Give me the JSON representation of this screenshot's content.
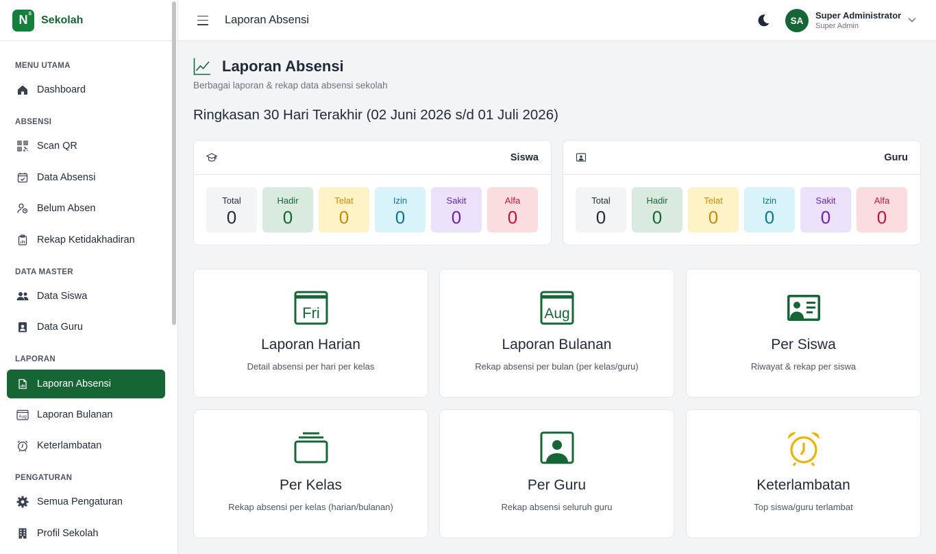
{
  "brand": {
    "name": "Sekolah",
    "logo_letter": "N",
    "logo_mark": "S"
  },
  "sidebar": {
    "sections": [
      {
        "label": "MENU UTAMA"
      },
      {
        "label": "ABSENSI"
      },
      {
        "label": "DATA MASTER"
      },
      {
        "label": "LAPORAN"
      },
      {
        "label": "PENGATURAN"
      }
    ],
    "items": [
      {
        "label": "Dashboard",
        "icon": "home-icon"
      },
      {
        "label": "Scan QR",
        "icon": "qr-code-icon"
      },
      {
        "label": "Data Absensi",
        "icon": "calendar-check-icon"
      },
      {
        "label": "Belum Absen",
        "icon": "user-clock-icon"
      },
      {
        "label": "Rekap Ketidakhadiran",
        "icon": "clipboard-chart-icon"
      },
      {
        "label": "Data Siswa",
        "icon": "users-icon"
      },
      {
        "label": "Data Guru",
        "icon": "teacher-badge-icon"
      },
      {
        "label": "Laporan Absensi",
        "icon": "report-icon",
        "active": true
      },
      {
        "label": "Laporan Bulanan",
        "icon": "calendar-month-icon"
      },
      {
        "label": "Keterlambatan",
        "icon": "alarm-icon"
      },
      {
        "label": "Semua Pengaturan",
        "icon": "gear-icon"
      },
      {
        "label": "Profil Sekolah",
        "icon": "building-icon"
      }
    ]
  },
  "header": {
    "title": "Laporan Absensi",
    "user": {
      "initials": "SA",
      "name": "Super Administrator",
      "role": "Super Admin"
    }
  },
  "page": {
    "title": "Laporan Absensi",
    "subtitle": "Berbagai laporan & rekap data absensi sekolah",
    "summary_title": "Ringkasan 30 Hari Terakhir (02 Juni 2026 s/d 01 Juli 2026)"
  },
  "stats": {
    "siswa": {
      "title": "Siswa",
      "boxes": [
        {
          "label": "Total",
          "value": "0"
        },
        {
          "label": "Hadir",
          "value": "0"
        },
        {
          "label": "Telat",
          "value": "0"
        },
        {
          "label": "Izin",
          "value": "0"
        },
        {
          "label": "Sakit",
          "value": "0"
        },
        {
          "label": "Alfa",
          "value": "0"
        }
      ]
    },
    "guru": {
      "title": "Guru",
      "boxes": [
        {
          "label": "Total",
          "value": "0"
        },
        {
          "label": "Hadir",
          "value": "0"
        },
        {
          "label": "Telat",
          "value": "0"
        },
        {
          "label": "Izin",
          "value": "0"
        },
        {
          "label": "Sakit",
          "value": "0"
        },
        {
          "label": "Alfa",
          "value": "0"
        }
      ]
    }
  },
  "colors": {
    "primary": "#166534",
    "accent_yellow": "#eab308",
    "total_bg": "#f3f4f6",
    "total_fg": "#1f2937",
    "hadir_bg": "#d9eadf",
    "hadir_fg": "#166534",
    "telat_bg": "#fef3c7",
    "telat_fg": "#ca8a04",
    "izin_bg": "#d9f3fb",
    "izin_fg": "#0e7490",
    "sakit_bg": "#ebe1fb",
    "sakit_fg": "#6b21a8",
    "alfa_bg": "#fbdde0",
    "alfa_fg": "#be123c"
  },
  "menu_cards": [
    {
      "title": "Laporan Harian",
      "desc": "Detail absensi per hari per kelas",
      "icon": "calendar-day-icon",
      "icon_text": "Fri"
    },
    {
      "title": "Laporan Bulanan",
      "desc": "Rekap absensi per bulan (per kelas/guru)",
      "icon": "calendar-month-icon",
      "icon_text": "Aug"
    },
    {
      "title": "Per Siswa",
      "desc": "Riwayat & rekap per siswa",
      "icon": "id-card-icon"
    },
    {
      "title": "Per Kelas",
      "desc": "Rekap absensi per kelas (harian/bulanan)",
      "icon": "collection-icon"
    },
    {
      "title": "Per Guru",
      "desc": "Rekap absensi seluruh guru",
      "icon": "person-video-icon"
    },
    {
      "title": "Keterlambatan",
      "desc": "Top siswa/guru terlambat",
      "icon": "alarm-icon"
    }
  ]
}
